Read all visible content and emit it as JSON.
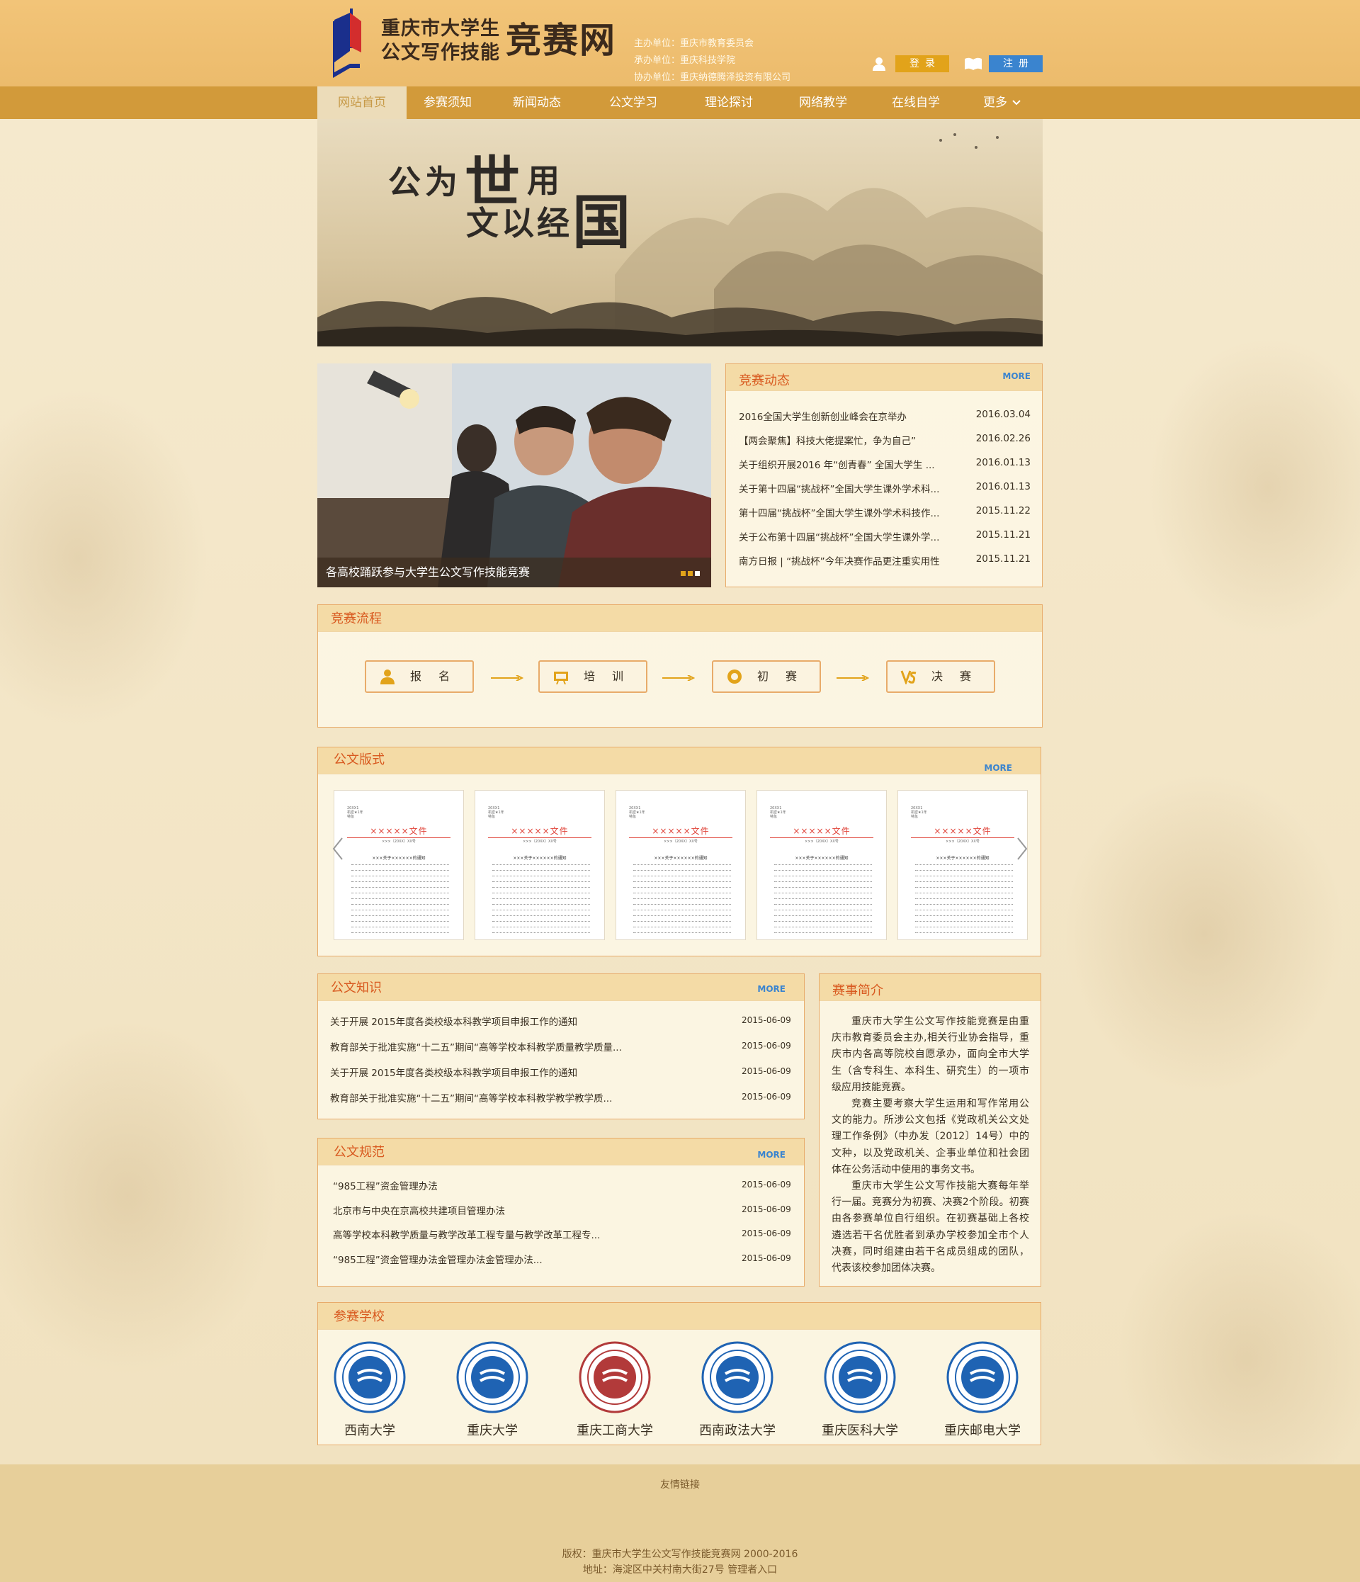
{
  "header": {
    "title_line1": "重庆市大学生",
    "title_line2": "公文写作技能",
    "title_big": "竞赛网",
    "org_lines": [
      "主办单位：重庆市教育委员会",
      "承办单位：重庆科技学院",
      "协办单位：重庆纳德腾泽投资有限公司"
    ],
    "login_label": "登录",
    "register_label": "注册"
  },
  "nav": {
    "items": [
      "网站首页",
      "参赛须知",
      "新闻动态",
      "公文学习",
      "理论探讨",
      "网络教学",
      "在线自学",
      "更多"
    ],
    "active_index": 0
  },
  "banner": {
    "chars": [
      "公",
      "为",
      "世",
      "用",
      "文",
      "以",
      "经",
      "国"
    ]
  },
  "photo": {
    "caption": "各高校踊跃参与大学生公文写作技能竞赛",
    "slide_count": 3,
    "active_slide": 2
  },
  "news": {
    "title": "竞赛动态",
    "more": "MORE",
    "items": [
      {
        "text": "2016全国大学生创新创业峰会在京举办",
        "date": "2016.03.04"
      },
      {
        "text": "【两会聚焦】科技大佬提案忙，争为自己”",
        "date": "2016.02.26"
      },
      {
        "text": "关于组织开展2016 年“创青春” 全国大学生 ...",
        "date": "2016.01.13"
      },
      {
        "text": "关于第十四届“挑战杯”全国大学生课外学术科...",
        "date": "2016.01.13"
      },
      {
        "text": " 第十四届“挑战杯”全国大学生课外学术科技作...",
        "date": "2015.11.22"
      },
      {
        "text": "关于公布第十四届“挑战杯”全国大学生课外学...",
        "date": "2015.11.21"
      },
      {
        "text": "南方日报 | “挑战杯”今年决赛作品更注重实用性",
        "date": "2015.11.21"
      }
    ]
  },
  "process": {
    "title": "竞赛流程",
    "steps": [
      "报名",
      "培训",
      "初赛",
      "决赛"
    ]
  },
  "formats": {
    "title": "公文版式",
    "more": "MORE",
    "doc_header": [
      "20XX1",
      "机密★1年",
      "特急"
    ],
    "doc_title": "×××××文件",
    "doc_number": "×××〔20XX〕XX号",
    "doc_subject": "×××关于××××××的通知",
    "count": 5
  },
  "knowledge": {
    "title": "公文知识",
    "more": "MORE",
    "items": [
      {
        "text": "关于开展 2015年度各类校级本科教学项目申报工作的通知",
        "date": "2015-06-09"
      },
      {
        "text": "教育部关于批准实施“十二五”期间“高等学校本科教学质量教学质量...",
        "date": "2015-06-09"
      },
      {
        "text": "关于开展 2015年度各类校级本科教学项目申报工作的通知",
        "date": "2015-06-09"
      },
      {
        "text": "教育部关于批准实施“十二五”期间“高等学校本科教学教学教学质...",
        "date": "2015-06-09"
      }
    ]
  },
  "norms": {
    "title": "公文规范",
    "more": "MORE",
    "items": [
      {
        "text": "“985工程”资金管理办法",
        "date": "2015-06-09"
      },
      {
        "text": "北京市与中央在京高校共建项目管理办法",
        "date": "2015-06-09"
      },
      {
        "text": "高等学校本科教学质量与教学改革工程专量与教学改革工程专...",
        "date": "2015-06-09"
      },
      {
        "text": "“985工程”资金管理办法金管理办法金管理办法...",
        "date": "2015-06-09"
      }
    ]
  },
  "intro": {
    "title": "赛事简介",
    "paragraphs": [
      "重庆市大学生公文写作技能竞赛是由重庆市教育委员会主办,相关行业协会指导，重庆市内各高等院校自愿承办，面向全市大学生（含专科生、本科生、研究生）的一项市级应用技能竞赛。",
      "竞赛主要考察大学生运用和写作常用公文的能力。所涉公文包括《党政机关公文处理工作条例》（中办发〔2012〕14号）中的文种，以及党政机关、企事业单位和社会团体在公务活动中使用的事务文书。",
      "重庆市大学生公文写作技能大赛每年举行一届。竞赛分为初赛、决赛2个阶段。初赛由各参赛单位自行组织。在初赛基础上各校遴选若干名优胜者到承办学校参加全市个人决赛，同时组建由若干名成员组成的团队，代表该校参加团体决赛。"
    ]
  },
  "schools": {
    "title": "参赛学校",
    "items": [
      {
        "name": "西南大学",
        "color": "#1f63b3"
      },
      {
        "name": "重庆大学",
        "color": "#1f63b3"
      },
      {
        "name": "重庆工商大学",
        "color": "#b23a3a"
      },
      {
        "name": "西南政法大学",
        "color": "#1f63b3"
      },
      {
        "name": "重庆医科大学",
        "color": "#1f63b3"
      },
      {
        "name": "重庆邮电大学",
        "color": "#1f63b3"
      }
    ]
  },
  "footer": {
    "links_label": "友情链接",
    "copyright": "版权：重庆市大学生公文写作技能竞赛网 2000-2016",
    "address": "地址：海淀区中关村南大街27号 管理者入口"
  },
  "colors": {
    "header_bg": "#eebf70",
    "nav_bg": "#d29a3a",
    "accent": "#d8591f",
    "more_link": "#3a84cf",
    "login_btn": "#e2a31a",
    "register_btn": "#3a84cf"
  }
}
